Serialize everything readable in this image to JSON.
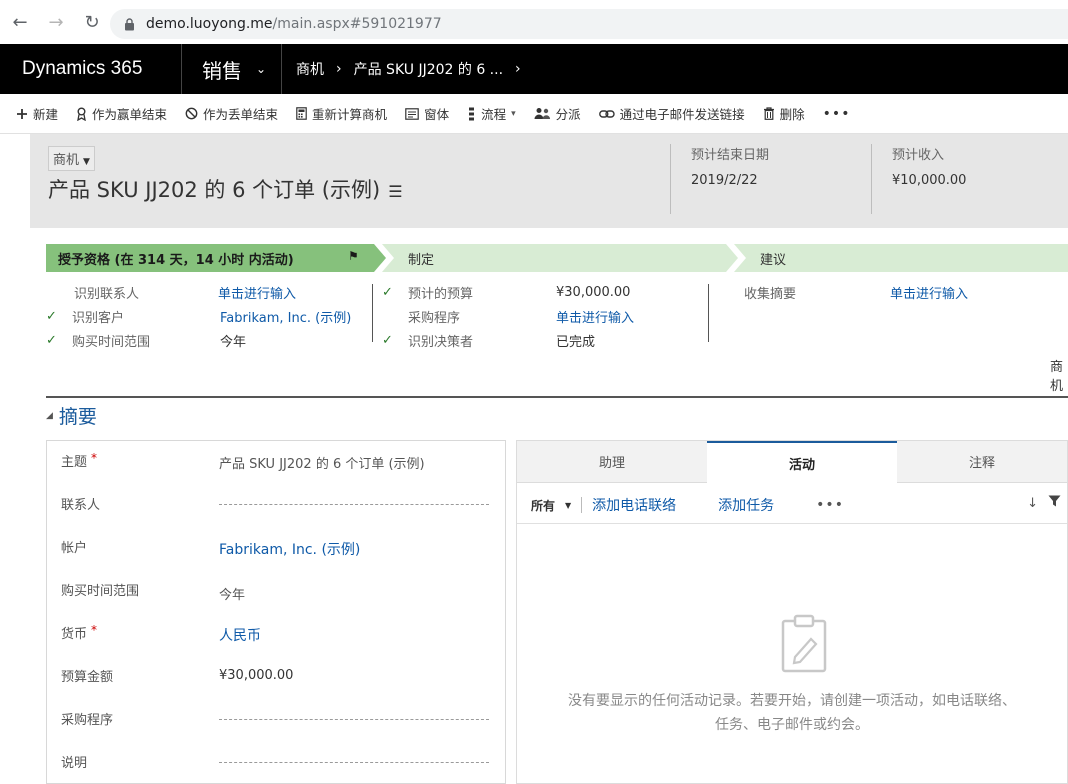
{
  "browser": {
    "url_host": "demo.luoyong.me",
    "url_path": "/main.aspx#591021977"
  },
  "app": {
    "brand": "Dynamics 365",
    "module": "销售",
    "breadcrumb": [
      "商机",
      "产品 SKU JJ202 的 6 ..."
    ]
  },
  "commands": [
    {
      "icon": "plus-icon",
      "label": "新建"
    },
    {
      "icon": "award-icon",
      "label": "作为赢单结束"
    },
    {
      "icon": "block-icon",
      "label": "作为丢单结束"
    },
    {
      "icon": "calculator-icon",
      "label": "重新计算商机"
    },
    {
      "icon": "form-icon",
      "label": "窗体"
    },
    {
      "icon": "flow-icon",
      "label": "流程"
    },
    {
      "icon": "users-icon",
      "label": "分派"
    },
    {
      "icon": "link-icon",
      "label": "通过电子邮件发送链接"
    },
    {
      "icon": "trash-icon",
      "label": "删除"
    }
  ],
  "record": {
    "entity": "商机",
    "title": "产品 SKU JJ202 的 6 个订单 (示例)",
    "header_fields": [
      {
        "label": "预计结束日期",
        "value": "2019/2/22"
      },
      {
        "label": "预计收入",
        "value": "¥10,000.00"
      }
    ]
  },
  "process": {
    "stages": [
      {
        "label": "授予资格 (在 314 天，14 小时 内活动)"
      },
      {
        "label": "制定"
      },
      {
        "label": "建议"
      }
    ],
    "steps_col1": [
      {
        "label": "识别联系人",
        "value": "单击进行输入"
      },
      {
        "label": "识别客户",
        "value": "Fabrikam, Inc. (示例)"
      },
      {
        "label": "购买时间范围",
        "value": "今年"
      }
    ],
    "steps_col2": [
      {
        "label": "预计的预算",
        "value": "¥30,000.00"
      },
      {
        "label": "采购程序",
        "value": "单击进行输入"
      },
      {
        "label": "识别决策者",
        "value": "已完成"
      }
    ],
    "steps_col3": [
      {
        "label": "收集摘要",
        "value": "单击进行输入"
      }
    ],
    "truncated_label": "商机"
  },
  "summary": {
    "title": "摘要",
    "fields": [
      {
        "label": "主题",
        "value": "产品 SKU JJ202 的 6 个订单 (示例)"
      },
      {
        "label": "联系人",
        "value": ""
      },
      {
        "label": "帐户",
        "value": "Fabrikam, Inc. (示例)"
      },
      {
        "label": "购买时间范围",
        "value": "今年"
      },
      {
        "label": "货币",
        "value": "人民币"
      },
      {
        "label": "预算金额",
        "value": "¥30,000.00"
      },
      {
        "label": "采购程序",
        "value": ""
      },
      {
        "label": "说明",
        "value": ""
      }
    ]
  },
  "activity": {
    "tabs": [
      "助理",
      "活动",
      "注释"
    ],
    "filter": "所有",
    "add_phone": "添加电话联络",
    "add_task": "添加任务",
    "more": "•••",
    "empty_line1": "没有要显示的任何活动记录。若要开始，请创建一项活动，如电话联络、",
    "empty_line2": "任务、电子邮件或约会。"
  },
  "colors": {
    "accent": "#1b5b9c",
    "link": "#0f5aa8",
    "stage_active": "#86c17c",
    "stage_inactive": "#d8ecd4",
    "header_bg": "#000000"
  }
}
